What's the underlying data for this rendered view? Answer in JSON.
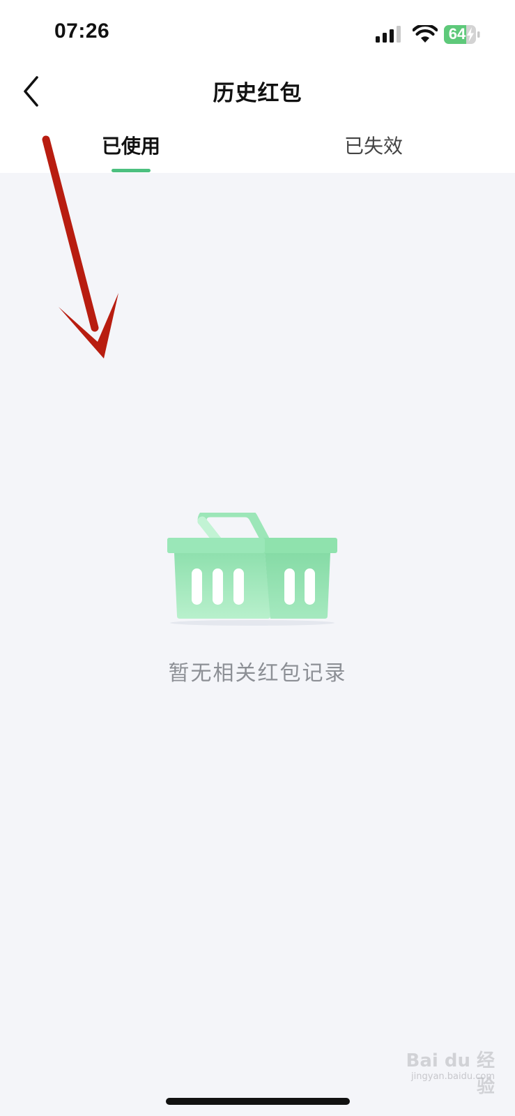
{
  "status_bar": {
    "time": "07:26",
    "battery_level": "64",
    "icons": [
      "signal-icon",
      "wifi-icon",
      "battery-charging-icon"
    ]
  },
  "nav": {
    "title": "历史红包",
    "back_icon": "chevron-left-icon"
  },
  "tabs": [
    {
      "label": "已使用",
      "selected": true
    },
    {
      "label": "已失效",
      "selected": false
    }
  ],
  "empty_state": {
    "icon": "basket-icon",
    "message": "暂无相关红包记录"
  },
  "watermark": {
    "brand": "Bai du 经验",
    "url": "jingyan.baidu.com"
  },
  "colors": {
    "accent": "#4cc07f",
    "background": "#f4f5f9",
    "annotation_arrow": "#b81d10",
    "battery": "#5ec97a",
    "empty_text": "#8c8f95"
  }
}
